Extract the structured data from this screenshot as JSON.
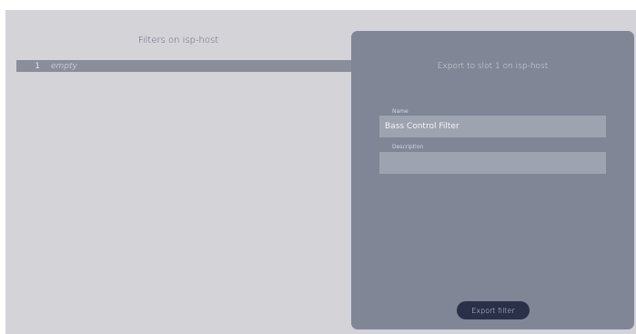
{
  "left": {
    "title": "Filters on isp-host",
    "slots": [
      {
        "number": "1",
        "label": "empty"
      }
    ]
  },
  "panel": {
    "title": "Export to slot 1 on isp-host",
    "name_label": "Name",
    "name_value": "Bass Control Filter",
    "description_label": "Description",
    "description_value": "",
    "export_button": "Export filter"
  },
  "colors": {
    "app_bg": "#d3d3d8",
    "panel_bg": "#808696",
    "selected_row": "#8a8d9a",
    "button_bg": "#2a3048"
  }
}
